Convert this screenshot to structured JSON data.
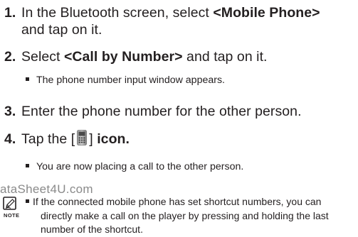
{
  "steps": [
    {
      "number": "1.",
      "before": "In the Bluetooth screen, select ",
      "bold": "<Mobile Phone>",
      "after": "",
      "continuation": "and tap on it."
    },
    {
      "number": "2.",
      "before": "Select ",
      "bold": "<Call by Number>",
      "after": " and tap on it.",
      "bullet": "The phone number input window appears."
    },
    {
      "number": "3.",
      "text": "Enter the phone number for the other person."
    },
    {
      "number": "4.",
      "before": "Tap the [",
      "after_icon": "] ",
      "bold": "icon.",
      "icon": "phone-keypad-icon",
      "bullet": "You are now placing a call to the other person."
    }
  ],
  "watermark": "ataSheet4U.com",
  "note": {
    "label": "NOTE",
    "icon": "note-pencil-icon",
    "line1": "If the connected mobile phone has set shortcut numbers, you can",
    "line2": "directly make a call on the player by pressing and holding the last",
    "line3": "number of the shortcut."
  }
}
